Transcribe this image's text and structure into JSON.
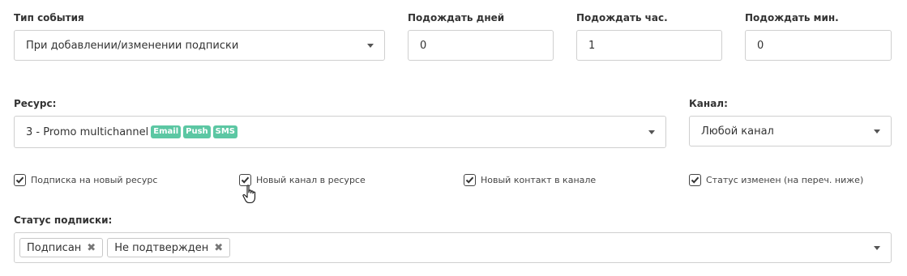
{
  "event_type": {
    "label": "Тип события",
    "value": "При добавлении/изменении подписки"
  },
  "wait_days": {
    "label": "Подождать дней",
    "value": "0"
  },
  "wait_hours": {
    "label": "Подождать час.",
    "value": "1"
  },
  "wait_minutes": {
    "label": "Подождать мин.",
    "value": "0"
  },
  "resource": {
    "label": "Ресурс:",
    "value": "3 - Promo multichannel",
    "badges": [
      "Email",
      "Push",
      "SMS"
    ],
    "badge_color": "#5cc7a3"
  },
  "channel": {
    "label": "Канал:",
    "value": "Любой канал"
  },
  "checkboxes": [
    {
      "label": "Подписка на новый ресурс",
      "checked": true
    },
    {
      "label": "Новый канал в ресурсе",
      "checked": true
    },
    {
      "label": "Новый контакт в канале",
      "checked": true
    },
    {
      "label": "Статус изменен (на переч. ниже)",
      "checked": true
    }
  ],
  "subscription_status": {
    "label": "Статус подписки:",
    "tags": [
      "Подписан",
      "Не подтвержден"
    ]
  },
  "icons": {
    "dropdown": "chevron-down-icon",
    "check": "checkmark-icon",
    "remove": "close-icon",
    "cursor": "hand-pointer-icon"
  }
}
